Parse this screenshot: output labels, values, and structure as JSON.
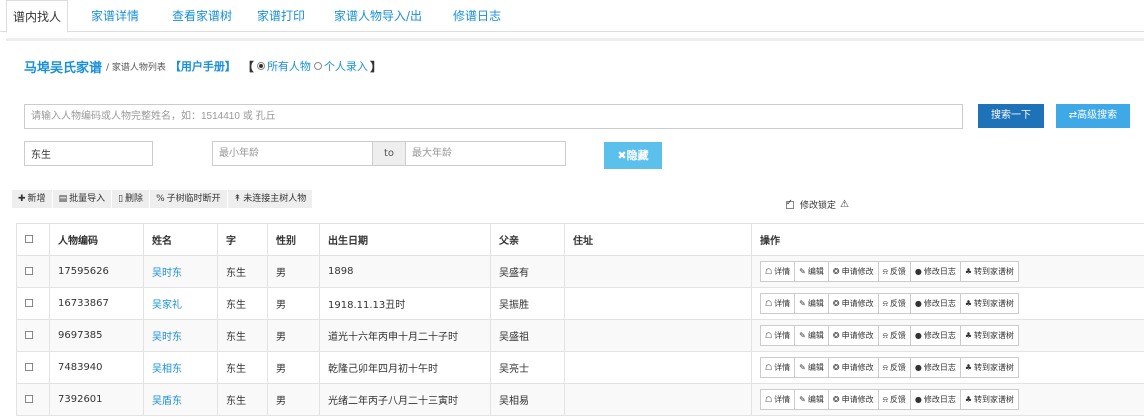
{
  "tabs": [
    "谱内找人",
    "家谱详情",
    "查看家谱树",
    "家谱打印",
    "家谱人物导入/出",
    "修谱日志"
  ],
  "title": {
    "main": "马埠吴氏家谱",
    "sub": "/ 家谱人物列表",
    "manual": "【用户手册】",
    "bracket_open": "【",
    "bracket_close": "】",
    "radio_all": "所有人物",
    "radio_personal": "个人录入"
  },
  "search": {
    "placeholder": "请输入人物编码或人物完整姓名，如：1514410 或 孔丘",
    "search_button": "搜索一下",
    "advanced_button": "⇄高级搜索",
    "zi_value": "东生",
    "min_age_placeholder": "最小年龄",
    "to_label": "to",
    "max_age_placeholder": "最大年龄",
    "hide_button": "✖隐藏"
  },
  "toolbar": {
    "add": "新增",
    "batch_import": "批量导入",
    "delete": "删除",
    "disconnect": "子树临时断开",
    "unlinked": "未连接主树人物",
    "lock_label": "修改锁定"
  },
  "table": {
    "headers": [
      "人物编码",
      "姓名",
      "字",
      "性别",
      "出生日期",
      "父亲",
      "住址",
      "操作"
    ],
    "rows": [
      [
        "17595626",
        "吴时东",
        "东生",
        "男",
        "1898",
        "吴盛有",
        ""
      ],
      [
        "16733867",
        "吴家礼",
        "东生",
        "男",
        "1918.11.13丑时",
        "吴振胜",
        ""
      ],
      [
        "9697385",
        "吴时东",
        "东生",
        "男",
        "道光十六年丙申十月二十子时",
        "吴盛祖",
        ""
      ],
      [
        "7483940",
        "吴相东",
        "东生",
        "男",
        "乾隆己卯年四月初十午时",
        "吴亮士",
        ""
      ],
      [
        "7392601",
        "吴盾东",
        "东生",
        "男",
        "光绪二年丙子八月二十三寅时",
        "吴相易",
        ""
      ]
    ],
    "actions": [
      "详情",
      "编辑",
      "申请修改",
      "反馈",
      "修改日志",
      "转到家谱树"
    ]
  },
  "colors": {
    "link": "#1a8fd9",
    "search_btn": "#1e73b8",
    "advanced_btn": "#3fa9e8",
    "hide_btn": "#5bc0ec"
  }
}
